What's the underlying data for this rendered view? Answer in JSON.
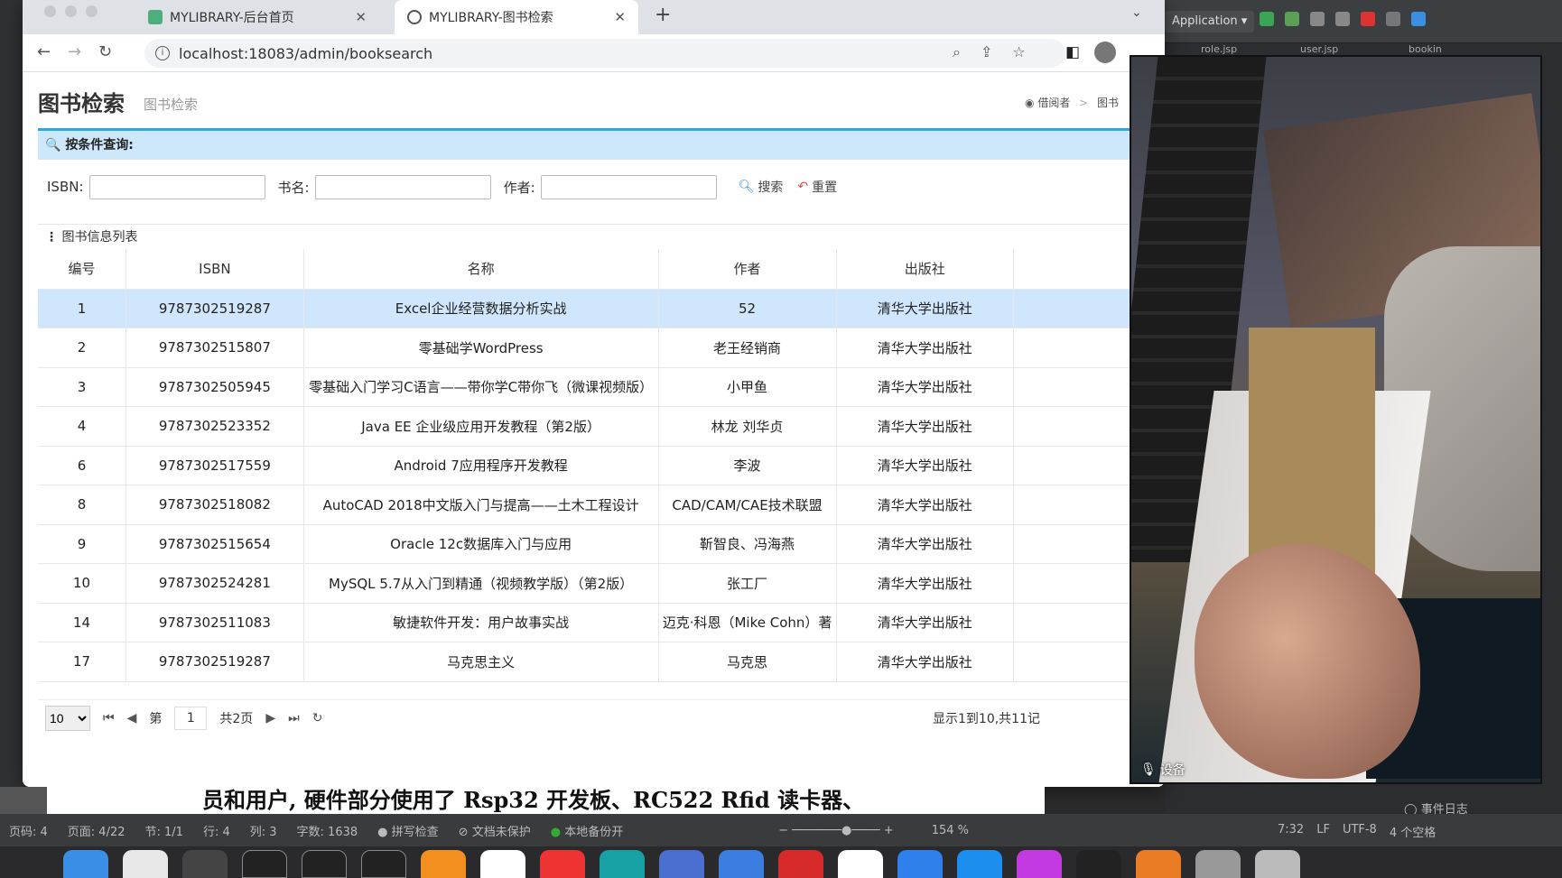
{
  "browser": {
    "tabs": [
      {
        "title": "MYLIBRARY-后台首页"
      },
      {
        "title": "MYLIBRARY-图书检索"
      }
    ],
    "url": "localhost:18083/admin/booksearch"
  },
  "ide": {
    "run_config": "Application",
    "tab_files": [
      "role.jsp",
      "user.jsp",
      "bookin"
    ],
    "status": [
      "7:32",
      "LF",
      "UTF-8",
      "4 个空格"
    ],
    "event_log": "事件日志"
  },
  "page": {
    "title": "图书检索",
    "subtitle": "图书检索",
    "breadcrumb": [
      "借阅者",
      ">",
      "图书"
    ],
    "search": {
      "heading": "按条件查询:",
      "isbn_label": "ISBN:",
      "name_label": "书名:",
      "author_label": "作者:",
      "search_btn": "搜索",
      "reset_btn": "重置"
    },
    "grid": {
      "title": "图书信息列表",
      "columns": [
        "编号",
        "ISBN",
        "名称",
        "作者",
        "出版社"
      ],
      "rows": [
        {
          "id": "1",
          "isbn": "9787302519287",
          "name": "Excel企业经营数据分析实战",
          "author": "52",
          "publisher": "清华大学出版社"
        },
        {
          "id": "2",
          "isbn": "9787302515807",
          "name": "零基础学WordPress",
          "author": "老王经销商",
          "publisher": "清华大学出版社"
        },
        {
          "id": "3",
          "isbn": "9787302505945",
          "name": "零基础入门学习C语言——带你学C带你飞（微课视频版）",
          "author": "小甲鱼",
          "publisher": "清华大学出版社"
        },
        {
          "id": "4",
          "isbn": "9787302523352",
          "name": "Java EE 企业级应用开发教程（第2版）",
          "author": "林龙 刘华贞",
          "publisher": "清华大学出版社"
        },
        {
          "id": "6",
          "isbn": "9787302517559",
          "name": "Android 7应用程序开发教程",
          "author": "李波",
          "publisher": "清华大学出版社"
        },
        {
          "id": "8",
          "isbn": "9787302518082",
          "name": "AutoCAD 2018中文版入门与提高——土木工程设计",
          "author": "CAD/CAM/CAE技术联盟",
          "publisher": "清华大学出版社"
        },
        {
          "id": "9",
          "isbn": "9787302515654",
          "name": "Oracle 12c数据库入门与应用",
          "author": "靳智良、冯海燕",
          "publisher": "清华大学出版社"
        },
        {
          "id": "10",
          "isbn": "9787302524281",
          "name": "MySQL 5.7从入门到精通（视频教学版）（第2版）",
          "author": "张工厂",
          "publisher": "清华大学出版社"
        },
        {
          "id": "14",
          "isbn": "9787302511083",
          "name": "敏捷软件开发：用户故事实战",
          "author": "迈克·科恩（Mike Cohn）著",
          "publisher": "清华大学出版社"
        },
        {
          "id": "17",
          "isbn": "9787302519287",
          "name": "马克思主义",
          "author": "马克思",
          "publisher": "清华大学出版社"
        }
      ]
    },
    "pager": {
      "page_size": "10",
      "page_label": "第",
      "current_page": "1",
      "total_pages": "共2页",
      "info": "显示1到10,共11记"
    }
  },
  "camera": {
    "label": "设备"
  },
  "document": {
    "line": "员和用户, 硬件部分使用了 Rsp32 开发板、RC522 Rfid 读卡器、",
    "status": {
      "page_num": "页码: 4",
      "page_of": "页面: 4/22",
      "section": "节: 1/1",
      "row": "行: 4",
      "col": "列: 3",
      "words": "字数: 1638",
      "spell": "拼写检查",
      "protect": "文档未保护",
      "backup": "本地备份开",
      "zoom": "154 %"
    }
  },
  "colors": {
    "accent": "#27a9e3",
    "selected_row": "#cfe6fc",
    "panel_head": "#cde8fb"
  }
}
